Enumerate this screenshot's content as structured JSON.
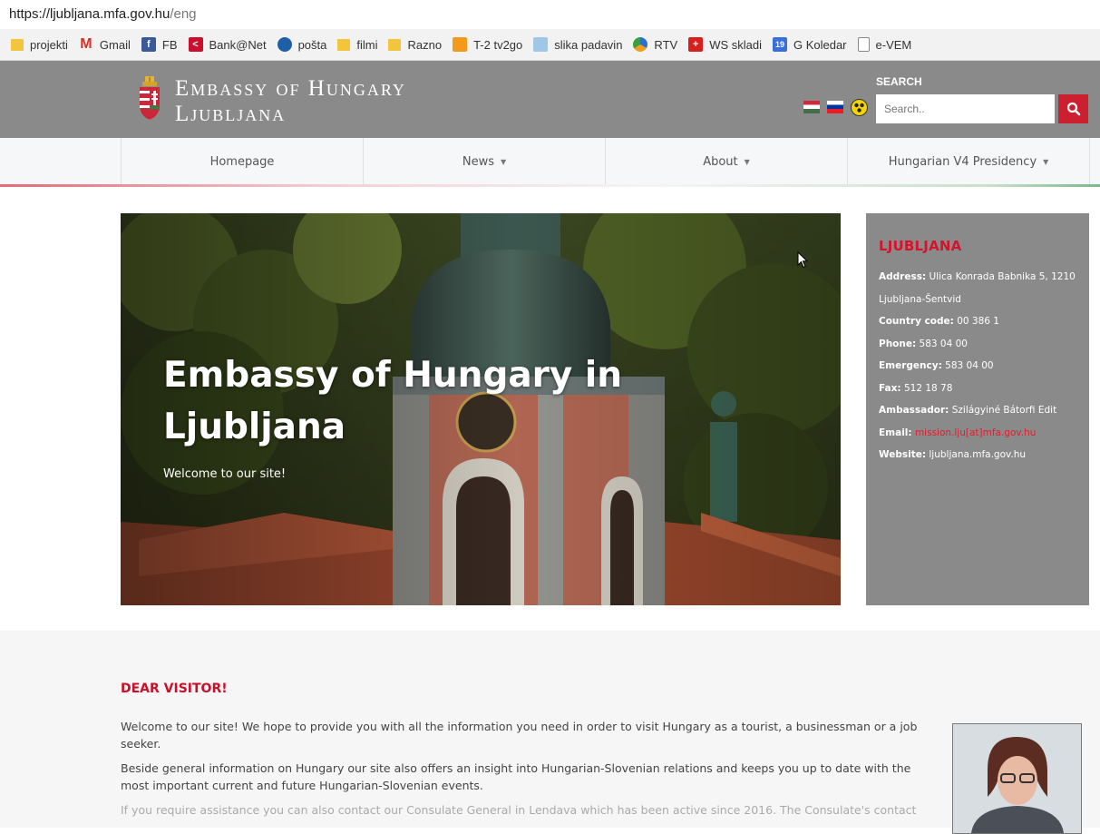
{
  "browser": {
    "url_host": "https://ljubljana.mfa.gov.hu",
    "url_path": "/eng",
    "bookmarks": [
      {
        "label": "projekti",
        "icon": "folder-icon"
      },
      {
        "label": "Gmail",
        "icon": "gmail-icon"
      },
      {
        "label": "FB",
        "icon": "facebook-icon"
      },
      {
        "label": "Bank@Net",
        "icon": "bank-icon"
      },
      {
        "label": "pošta",
        "icon": "posta-icon"
      },
      {
        "label": "filmi",
        "icon": "folder-icon"
      },
      {
        "label": "Razno",
        "icon": "folder-icon"
      },
      {
        "label": "T-2 tv2go",
        "icon": "tv-icon"
      },
      {
        "label": "slika padavin",
        "icon": "weather-icon"
      },
      {
        "label": "RTV",
        "icon": "rtv-icon"
      },
      {
        "label": "WS skladi",
        "icon": "ws-icon"
      },
      {
        "label": "G Koledar",
        "icon": "calendar-icon",
        "icon_text": "19"
      },
      {
        "label": "e-VEM",
        "icon": "document-icon"
      }
    ]
  },
  "header": {
    "brand_line1": "Embassy of Hungary",
    "brand_line2": "Ljubljana",
    "search_label": "SEARCH",
    "search_placeholder": "Search..",
    "accent_color": "#cc1f2f"
  },
  "nav": {
    "items": [
      {
        "label": "Homepage",
        "dropdown": false
      },
      {
        "label": "News",
        "dropdown": true
      },
      {
        "label": "About",
        "dropdown": true
      },
      {
        "label": "Hungarian V4 Presidency",
        "dropdown": true
      }
    ]
  },
  "hero": {
    "title": "Embassy of Hungary in\nLjubljana",
    "subtitle": "Welcome to our site!"
  },
  "contact": {
    "city": "LJUBLJANA",
    "address_label": "Address:",
    "address_value": "Ulica Konrada Babnika 5, 1210 Ljubljana-Šentvid",
    "country_code_label": "Country code:",
    "country_code_value": "00 386 1",
    "phone_label": "Phone:",
    "phone_value": "583 04 00",
    "emergency_label": "Emergency:",
    "emergency_value": "583 04 00",
    "fax_label": "Fax:",
    "fax_value": "512 18 78",
    "ambassador_label": "Ambassador:",
    "ambassador_value": "Szilágyiné Bátorfi Edit",
    "email_label": "Email:",
    "email_value": "mission.lju[at]mfa.gov.hu",
    "website_label": "Website:",
    "website_value": "ljubljana.mfa.gov.hu"
  },
  "welcome": {
    "title": "DEAR VISITOR!",
    "paragraph1": "Welcome to our site! We hope to provide you with all the information you need in order to visit Hungary as a tourist, a businessman or a job seeker.",
    "paragraph2": "Beside general information on Hungary our site also offers an insight into Hungarian-Slovenian relations and keeps you up to date with the most important current and future Hungarian-Slovenian events.",
    "paragraph3": "If you require assistance you can also contact our Consulate General in Lendava which has been active since 2016. The Consulate's contact"
  }
}
